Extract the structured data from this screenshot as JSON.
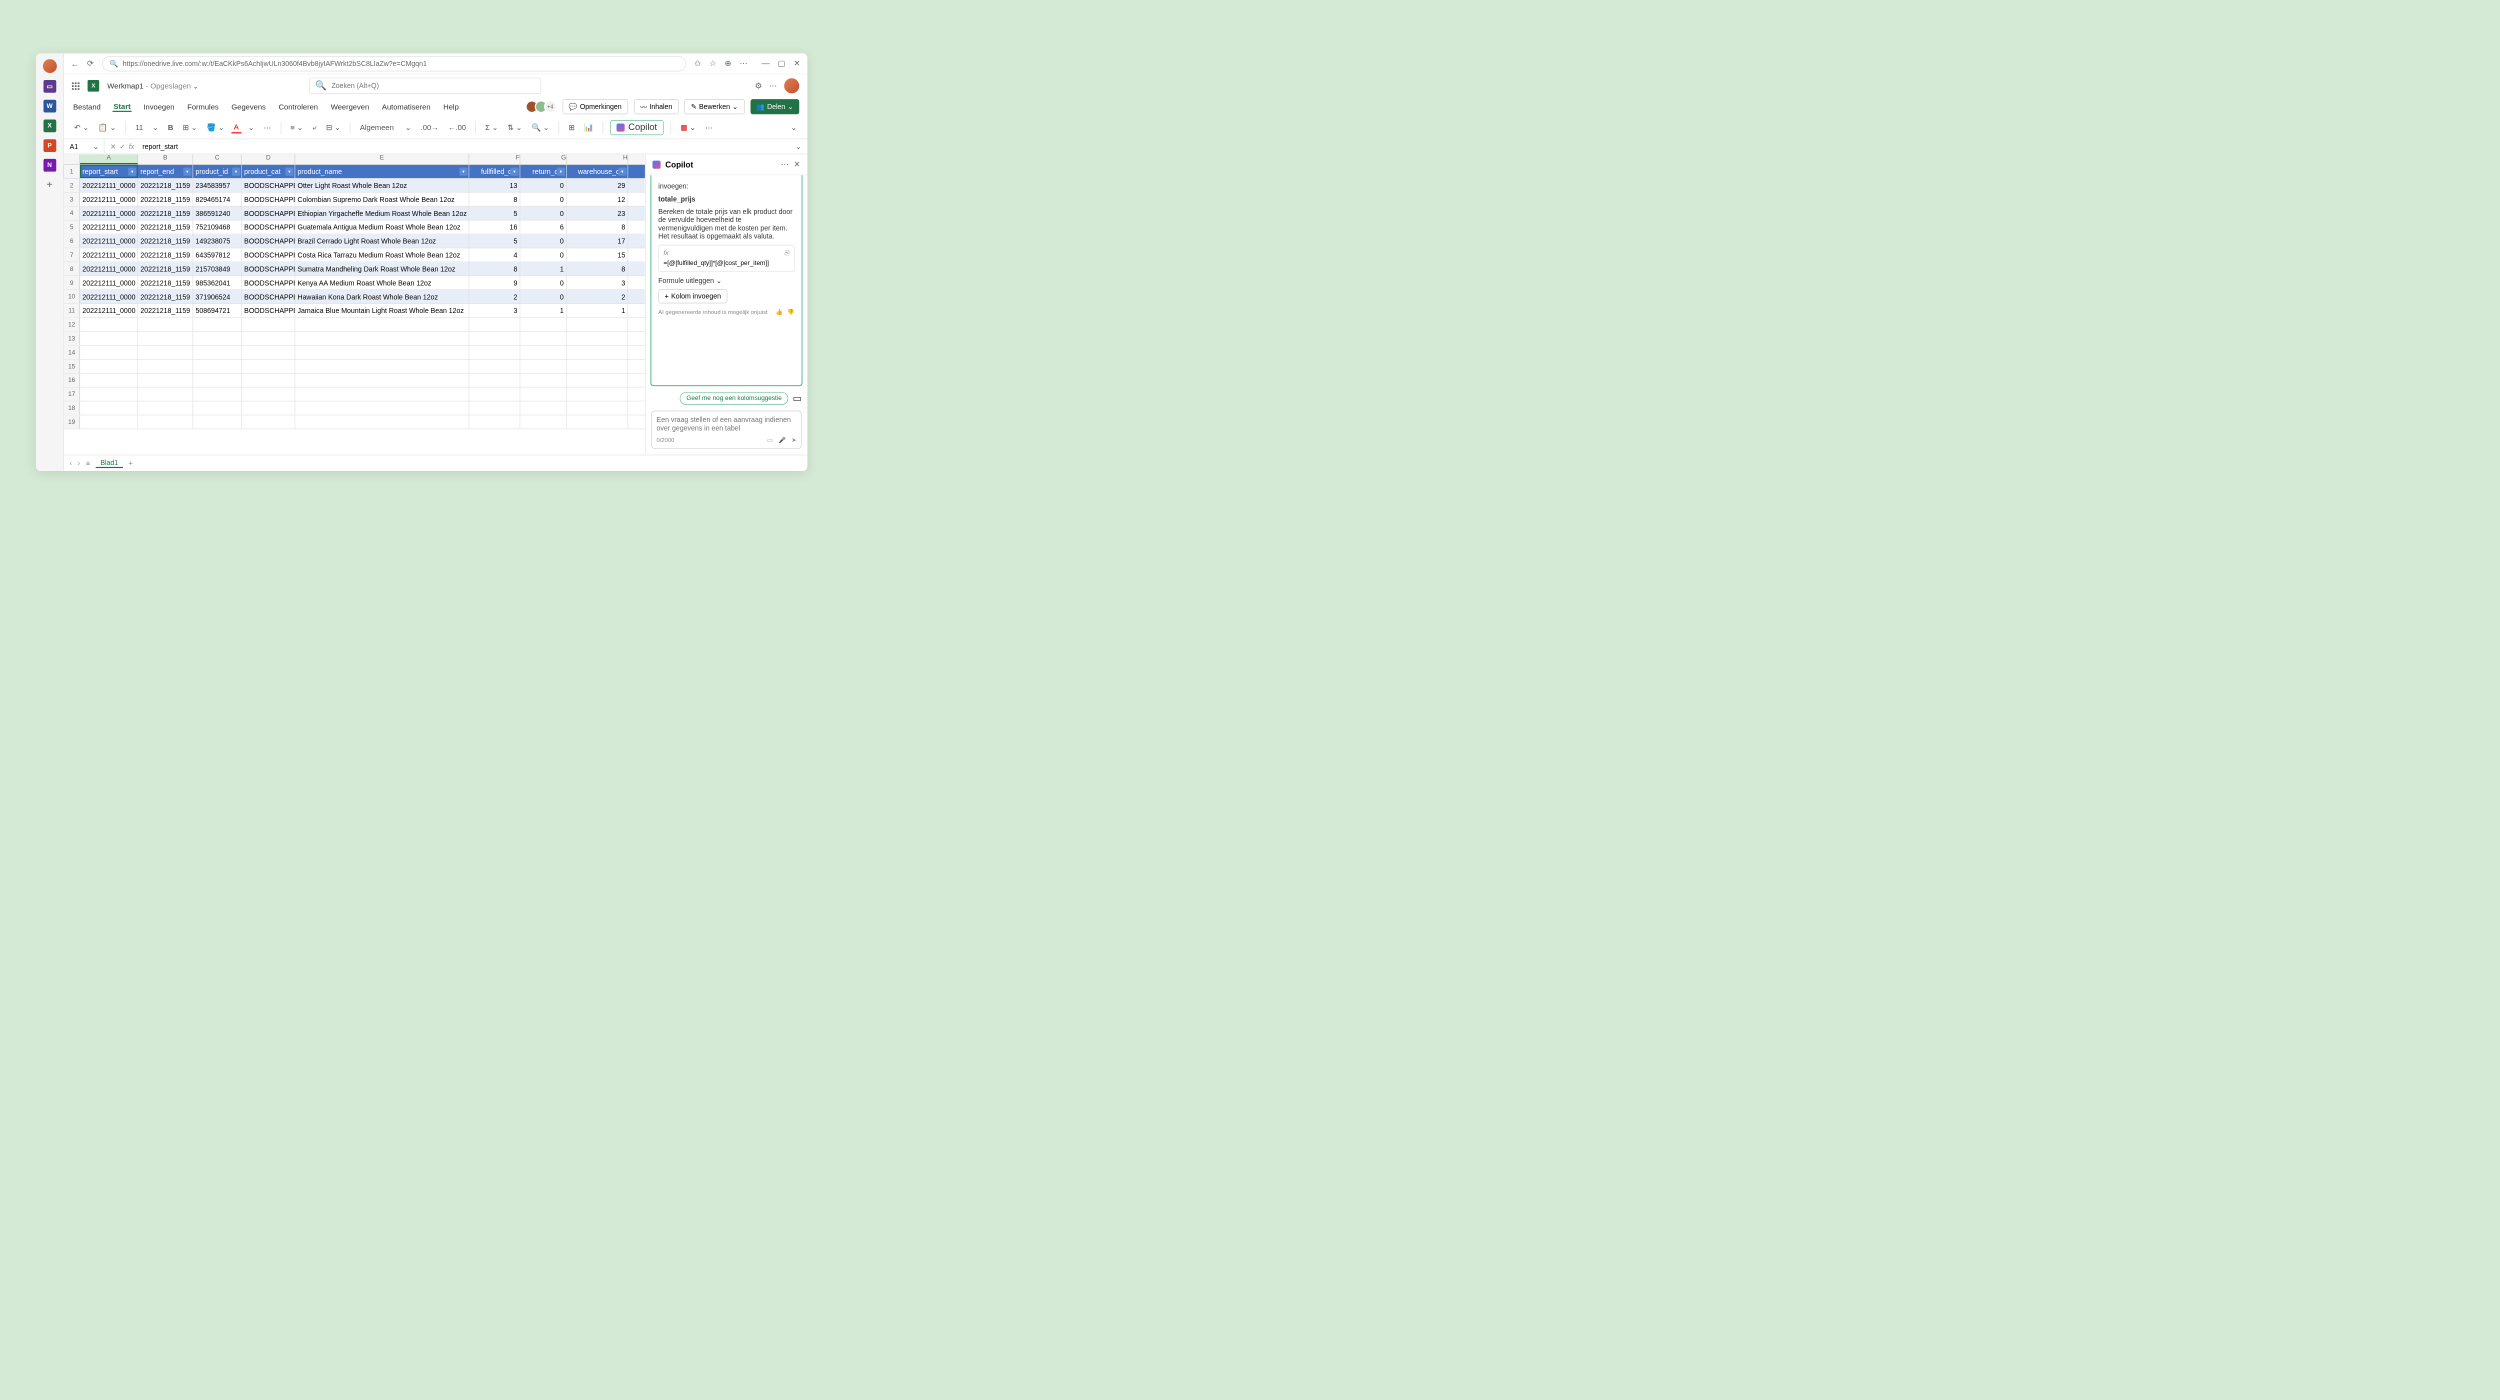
{
  "browser": {
    "url": "https://onedrive.live.com/:w:/t/EaCKkPs6AchIjwULn3060f4Bvb8jyIAFWrkt2bSC8LIaZw?e=CMgqn1"
  },
  "app": {
    "doc_title": "Werkmap1",
    "saved": "Opgeslagen",
    "search_placeholder": "Zoeken (Alt+Q)"
  },
  "tabs": {
    "file": "Bestand",
    "start": "Start",
    "insert": "Invoegen",
    "formulas": "Formules",
    "data": "Gegevens",
    "review": "Controleren",
    "view": "Weergeven",
    "automate": "Automatiseren",
    "help": "Help"
  },
  "tab_right": {
    "presence_more": "+4",
    "comments": "Opmerkingen",
    "catchup": "Inhalen",
    "edit": "Bewerken",
    "share": "Delen"
  },
  "toolbar": {
    "font_size": "11",
    "format": "Algemeen",
    "copilot": "Copilot"
  },
  "formula_bar": {
    "cell_ref": "A1",
    "formula": "report_start"
  },
  "columns": [
    "A",
    "B",
    "C",
    "D",
    "E",
    "F",
    "G",
    "H"
  ],
  "headers": [
    "report_start",
    "report_end",
    "product_id",
    "product_cat",
    "product_name",
    "fullfilled_qty",
    "return_qty",
    "warehouse_qty"
  ],
  "chart_data": {
    "type": "table",
    "columns": [
      "report_start",
      "report_end",
      "product_id",
      "product_cat",
      "product_name",
      "fullfilled_qty",
      "return_qty",
      "warehouse_qty"
    ],
    "rows": [
      [
        "202212111_0000",
        "20221218_1159",
        "234583957",
        "BOODSCHAPPE",
        "Otter Light Roast Whole Bean 12oz",
        "13",
        "0",
        "29"
      ],
      [
        "202212111_0000",
        "20221218_1159",
        "829465174",
        "BOODSCHAPPE",
        "Colombian Supremo Dark Roast Whole Bean 12oz",
        "8",
        "0",
        "12"
      ],
      [
        "202212111_0000",
        "20221218_1159",
        "386591240",
        "BOODSCHAPPE",
        "Ethiopian Yirgacheffe Medium Roast Whole Bean 12oz",
        "5",
        "0",
        "23"
      ],
      [
        "202212111_0000",
        "20221218_1159",
        "752109468",
        "BOODSCHAPPE",
        "Guatemala Antigua Medium Roast Whole Bean 12oz",
        "16",
        "6",
        "8"
      ],
      [
        "202212111_0000",
        "20221218_1159",
        "149238075",
        "BOODSCHAPPE",
        "Brazil Cerrado Light Roast Whole Bean 12oz",
        "5",
        "0",
        "17"
      ],
      [
        "202212111_0000",
        "20221218_1159",
        "643597812",
        "BOODSCHAPPE",
        "Costa Rica Tarrazu Medium Roast Whole Bean 12oz",
        "4",
        "0",
        "15"
      ],
      [
        "202212111_0000",
        "20221218_1159",
        "215703849",
        "BOODSCHAPPE",
        "Sumatra Mandheling Dark Roast Whole Bean 12oz",
        "8",
        "1",
        "8"
      ],
      [
        "202212111_0000",
        "20221218_1159",
        "985362041",
        "BOODSCHAPPE",
        "Kenya AA Medium Roast Whole Bean 12oz",
        "9",
        "0",
        "3"
      ],
      [
        "202212111_0000",
        "20221218_1159",
        "371906524",
        "BOODSCHAPPE",
        "Hawaiian Kona Dark Roast Whole Bean 12oz",
        "2",
        "0",
        "2"
      ],
      [
        "202212111_0000",
        "20221218_1159",
        "508694721",
        "BOODSCHAPPE",
        "Jamaica Blue Mountain Light Roast Whole Bean 12oz",
        "3",
        "1",
        "1"
      ]
    ]
  },
  "copilot": {
    "title": "Copilot",
    "intro": "invoegen:",
    "col_name": "totale_prijs",
    "desc": "Bereken de totale prijs van elk product door de vervulde hoeveelheid te vermenigvuldigen met de kosten per item. Het resultaat is opgemaakt als valuta.",
    "formula": "=[@[fulfilled_qty]]*[@[cost_per_item]]",
    "explain": "Formule uitleggen",
    "insert_col": "Kolom invoegen",
    "disclaimer": "AI gegenereerde inhoud is mogelijk onjuist",
    "suggest": "Geef me nog een kolomsuggestie",
    "input_placeholder": "Een vraag stellen of een aanvraag indienen over gegevens in een tabel",
    "counter": "0/2000"
  },
  "sheet": {
    "name": "Blad1"
  },
  "empty_rows": [
    12,
    13,
    14,
    15,
    16,
    17,
    18,
    19
  ]
}
